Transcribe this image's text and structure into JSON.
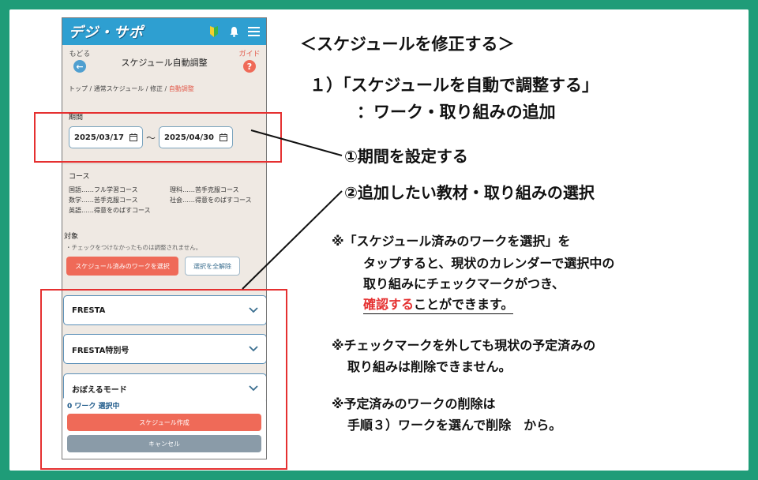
{
  "app": {
    "logo": "デジ・サポ",
    "header_icons": [
      "beginner-mark-icon",
      "bell-icon",
      "menu-icon"
    ],
    "back_label": "もどる",
    "title": "スケジュール自動調整",
    "guide_label": "ガイド",
    "breadcrumb": [
      "トップ",
      "通常スケジュール",
      "修正",
      "自動調整"
    ],
    "period": {
      "label": "期間",
      "start": "2025/03/17",
      "separator": "〜",
      "end": "2025/04/30"
    },
    "course": {
      "label": "コース",
      "items": [
        "国語……フル学習コース",
        "理科……苦手克服コース",
        "数学……苦手克服コース",
        "社会……得意をのばすコース",
        "英語……得意をのばすコース"
      ]
    },
    "target": {
      "label": "対象",
      "note": "・チェックをつけなかったものは調整されません。",
      "select_scheduled_button": "スケジュール済みのワークを選択",
      "clear_all_button": "選択を全解除"
    },
    "materials": [
      "FRESTA",
      "FRESTA特別号",
      "おぼえるモード"
    ],
    "bottom": {
      "selected_count": "0 ワーク 選択中",
      "create_button": "スケジュール作成",
      "cancel_button": "キャンセル"
    },
    "colors": {
      "header": "#2e9fd1",
      "accent": "#ef6a58",
      "highlight": "#e53030"
    }
  },
  "instructions": {
    "heading": "＜スケジュールを修正する＞",
    "step_title": "１）「スケジュールを自動で調整する」",
    "step_subtitle": "：ワーク・取り組みの追加",
    "point1": "①期間を設定する",
    "point2": "②追加したい教材・取り組みの選択",
    "note1_line1": "※「スケジュール済みのワークを選択」を",
    "note1_line2": "タップすると、現状のカレンダーで選択中の",
    "note1_line3": "取り組みにチェックマークがつき、",
    "note1_line4_red": "確認する",
    "note1_line4_rest": "ことができます。",
    "note2_line1": "※チェックマークを外しても現状の予定済みの",
    "note2_line2": "取り組みは削除できません。",
    "note3_line1": "※予定済みのワークの削除は",
    "note3_line2": "手順３）ワークを選んで削除　から。"
  }
}
